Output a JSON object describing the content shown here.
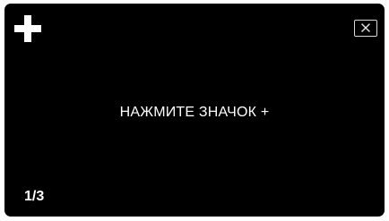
{
  "screen": {
    "background": "#000000",
    "add_button": {
      "icon": "plus-icon",
      "color": "#ffffff"
    },
    "close_button": {
      "icon": "close-icon",
      "border_color": "#d9d9d9"
    },
    "instruction_text": "НАЖМИТЕ ЗНАЧОК +",
    "page_indicator": "1/3"
  }
}
